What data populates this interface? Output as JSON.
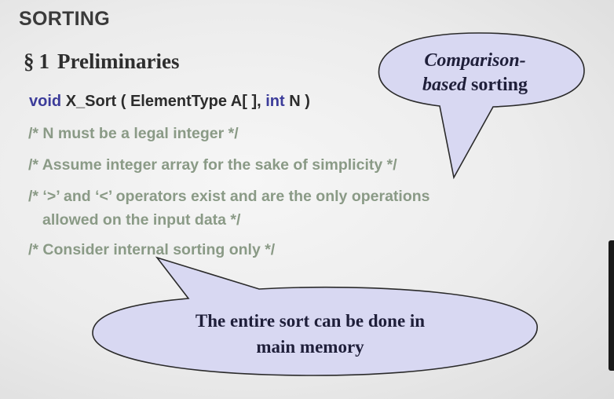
{
  "slide": {
    "title": "SORTING",
    "section": {
      "symbol": "§",
      "number": "1",
      "label": "Preliminaries"
    }
  },
  "code": {
    "return_type": "void",
    "function_name": "X_Sort",
    "open_paren": "(",
    "param1_type": "ElementType",
    "param1_name": "A[ ],",
    "param2_type": "int",
    "param2_name": "N",
    "close_paren": ")"
  },
  "comments": [
    "/* N must be a legal integer */",
    "/* Assume integer array for the sake of simplicity */",
    "/* ‘>’ and ‘<’ operators exist and are the only operations",
    "allowed on the input data */",
    "/* Consider internal sorting only */"
  ],
  "callouts": {
    "top": {
      "line1": "Comparison-",
      "line2_italic": "based",
      "line2_rest": " sorting"
    },
    "bottom": {
      "line1": "The entire sort can be done in",
      "line2": "main memory"
    },
    "fill_color": "#d8d8f2",
    "stroke_color": "#2a2a2a"
  }
}
